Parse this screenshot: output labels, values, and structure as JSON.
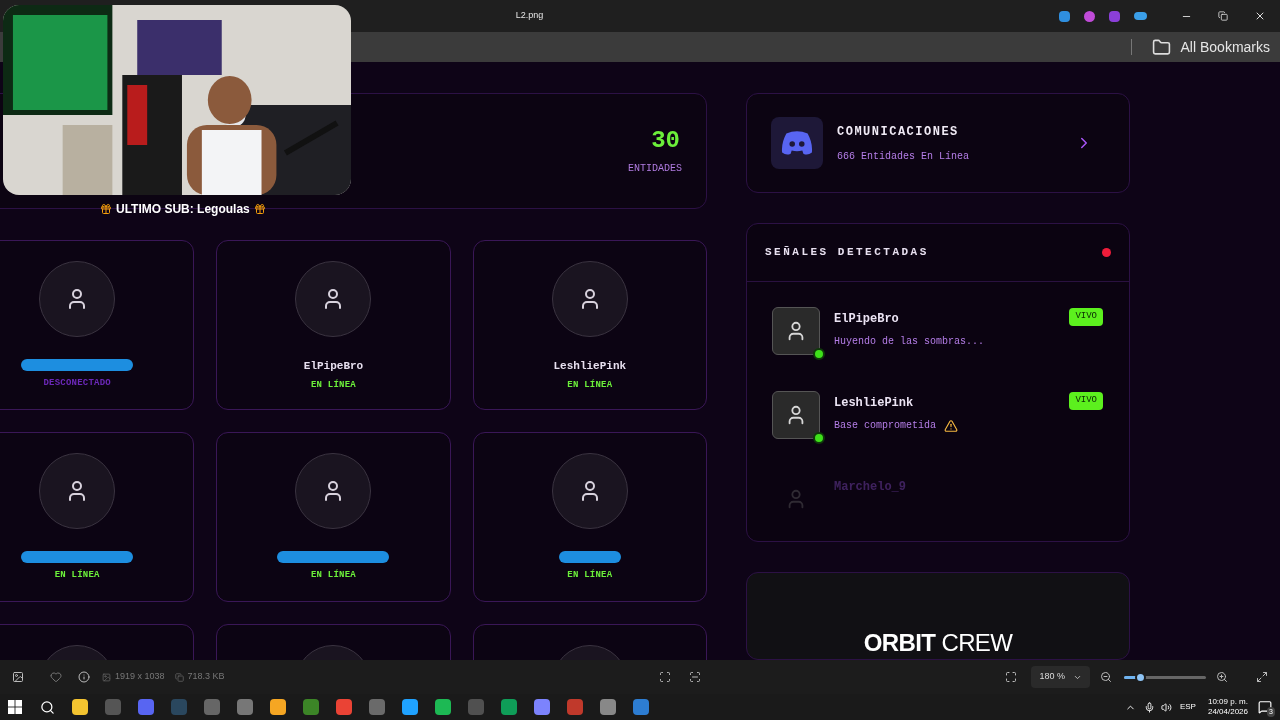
{
  "window": {
    "title": "L2.png"
  },
  "bookmarks": {
    "label": "All Bookmarks"
  },
  "stream_overlay": {
    "kind": "picture",
    "caption": "ULTIMO SUB: Legoulas"
  },
  "stats": {
    "value": "30",
    "label": "ENTIDADES"
  },
  "members": [
    {
      "kind": "card",
      "redacted": true,
      "status": "DESCONECTADO",
      "online": false
    },
    {
      "kind": "card",
      "name": "ElPipeBro",
      "status": "EN LÍNEA",
      "online": true
    },
    {
      "kind": "card",
      "name": "LeshliePink",
      "status": "EN LÍNEA",
      "online": true
    },
    {
      "kind": "card",
      "redacted": true,
      "status": "EN LÍNEA",
      "online": true
    },
    {
      "kind": "card",
      "redacted": true,
      "status": "EN LÍNEA",
      "online": true
    },
    {
      "kind": "card",
      "redacted": true,
      "status": "EN LÍNEA",
      "online": true
    },
    {
      "kind": "card"
    },
    {
      "kind": "card"
    },
    {
      "kind": "card"
    }
  ],
  "discord": {
    "title": "COMUNICACIONES",
    "subtitle": "666 Entidades En Línea"
  },
  "signals": {
    "title": "SEÑALES DETECTADAS",
    "live": true,
    "items": [
      {
        "name": "ElPipeBro",
        "message": "Huyendo de las sombras...",
        "badge": "VIVO",
        "online": true,
        "warning": false
      },
      {
        "name": "LeshliePink",
        "message": "Base comprometida",
        "badge": "VIVO",
        "online": true,
        "warning": true
      },
      {
        "name": "Marchelo_9",
        "online": false,
        "warning": false
      }
    ]
  },
  "brand": {
    "bold": "ORBIT",
    "light": "CREW"
  },
  "viewer": {
    "dimensions": "1919 x 1038",
    "size": "718.3 KB",
    "zoom": "180 %",
    "zoom_slider": {
      "level": 0.2
    }
  },
  "taskbar": {
    "language": "ESP",
    "time": "10:09 p. m.",
    "date": "24/04/2026",
    "notifications": "3"
  }
}
